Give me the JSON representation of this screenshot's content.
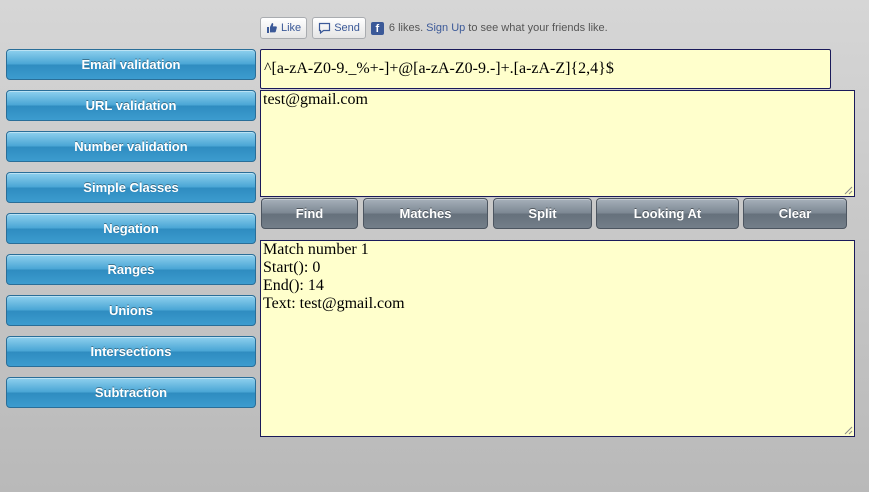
{
  "facebook": {
    "like_label": "Like",
    "send_label": "Send",
    "likes_text": "6 likes.",
    "signup_label": "Sign Up",
    "friends_text": "to see what your friends like."
  },
  "sidebar": {
    "items": [
      {
        "label": "Email validation"
      },
      {
        "label": "URL validation"
      },
      {
        "label": "Number validation"
      },
      {
        "label": "Simple Classes"
      },
      {
        "label": "Negation"
      },
      {
        "label": "Ranges"
      },
      {
        "label": "Unions"
      },
      {
        "label": "Intersections"
      },
      {
        "label": "Subtraction"
      }
    ]
  },
  "regex": {
    "value": "^[a-zA-Z0-9._%+-]+@[a-zA-Z0-9.-]+.[a-zA-Z]{2,4}$"
  },
  "input_text": {
    "value": "test@gmail.com"
  },
  "actions": {
    "find_label": "Find",
    "matches_label": "Matches",
    "split_label": "Split",
    "looking_at_label": "Looking At",
    "clear_label": "Clear"
  },
  "result": {
    "lines": [
      "Match number 1",
      "Start(): 0",
      "End(): 14",
      "Text: test@gmail.com"
    ]
  },
  "colors": {
    "field_background": "#ffffcc",
    "sidebar_button": "#3c9ccf",
    "action_button": "#737e89",
    "facebook_blue": "#3b5998"
  }
}
